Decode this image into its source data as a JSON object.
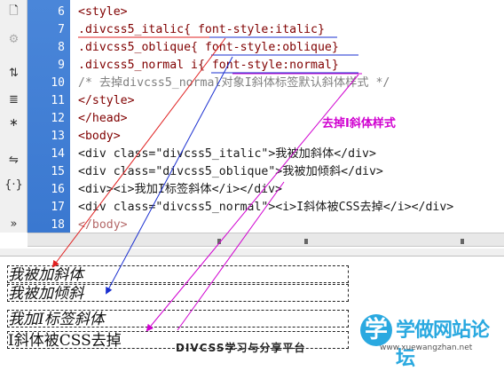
{
  "toolbar": {
    "icons": [
      "document-icon",
      "gear-icon",
      "expand-icon",
      "select-tag-icon",
      "collapse-icon",
      "indent-icon",
      "braces-icon",
      "chevron-down-icon"
    ]
  },
  "editor": {
    "lines": [
      {
        "num": "6",
        "text": "<style>"
      },
      {
        "num": "7",
        "text": ".divcss5_italic{ font-style:italic}"
      },
      {
        "num": "8",
        "text": ".divcss5_oblique{ font-style:oblique}"
      },
      {
        "num": "9",
        "text": ".divcss5_normal i{ font-style:normal}"
      },
      {
        "num": "10",
        "text": "/* 去掉divcss5_normal对象I斜体标签默认斜体样式 */"
      },
      {
        "num": "11",
        "text": "</style>"
      },
      {
        "num": "12",
        "text": "</head>"
      },
      {
        "num": "13",
        "text": "<body>"
      },
      {
        "num": "14",
        "text": "<div class=\"divcss5_italic\">我被加斜体</div>"
      },
      {
        "num": "15",
        "text": "<div class=\"divcss5_oblique\">我被加倾斜</div>"
      },
      {
        "num": "16",
        "text": "<div><i>我加I标签斜体</i></div>"
      },
      {
        "num": "17",
        "text": "<div class=\"divcss5_normal\"><i>I斜体被CSS去掉</i></div>"
      },
      {
        "num": "18",
        "text": "</body>"
      }
    ]
  },
  "annotation": "去掉I斜体样式",
  "preview": {
    "rows": [
      "我被加斜体",
      "我被加倾斜",
      "我加I标签斜体",
      "I斜体被CSS去掉"
    ]
  },
  "watermark": {
    "text": "DIVCSS学习与分享平台",
    "logo_mark": "学",
    "logo_name": "学做网站论坛",
    "logo_url": "www.xuewangzhan.net"
  },
  "colors": {
    "gutter": "#3a78d0",
    "arrow_red": "#e02020",
    "arrow_blue": "#1a2fd0",
    "arrow_magenta": "#d000d0"
  }
}
